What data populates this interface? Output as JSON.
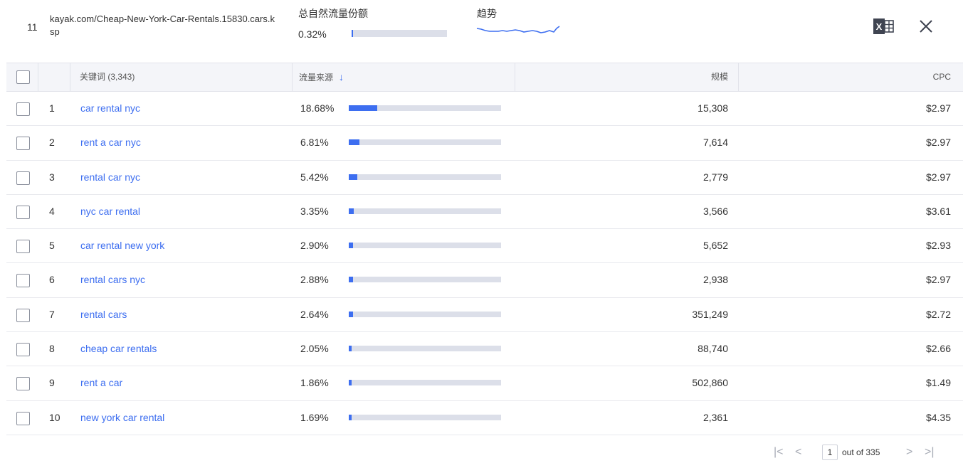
{
  "header": {
    "index": "11",
    "url": "kayak.com/Cheap-New-York-Car-Rentals.15830.cars.ksp",
    "share_label": "总自然流量份额",
    "share_value": "0.32%",
    "share_fraction": 0.0032,
    "trend_label": "趋势",
    "excel_icon": "excel-icon",
    "close_icon": "close-icon"
  },
  "table": {
    "columns": {
      "keyword": "关键词 (3,343)",
      "traffic": "流量来源",
      "volume": "规模",
      "cpc": "CPC"
    },
    "rows": [
      {
        "num": "1",
        "keyword": "car rental nyc",
        "pct": "18.68%",
        "fraction": 0.1868,
        "volume": "15,308",
        "cpc": "$2.97"
      },
      {
        "num": "2",
        "keyword": "rent a car nyc",
        "pct": "6.81%",
        "fraction": 0.0681,
        "volume": "7,614",
        "cpc": "$2.97"
      },
      {
        "num": "3",
        "keyword": "rental car nyc",
        "pct": "5.42%",
        "fraction": 0.0542,
        "volume": "2,779",
        "cpc": "$2.97"
      },
      {
        "num": "4",
        "keyword": "nyc car rental",
        "pct": "3.35%",
        "fraction": 0.0335,
        "volume": "3,566",
        "cpc": "$3.61"
      },
      {
        "num": "5",
        "keyword": "car rental new york",
        "pct": "2.90%",
        "fraction": 0.029,
        "volume": "5,652",
        "cpc": "$2.93"
      },
      {
        "num": "6",
        "keyword": "rental cars nyc",
        "pct": "2.88%",
        "fraction": 0.0288,
        "volume": "2,938",
        "cpc": "$2.97"
      },
      {
        "num": "7",
        "keyword": "rental cars",
        "pct": "2.64%",
        "fraction": 0.0264,
        "volume": "351,249",
        "cpc": "$2.72"
      },
      {
        "num": "8",
        "keyword": "cheap car rentals",
        "pct": "2.05%",
        "fraction": 0.0205,
        "volume": "88,740",
        "cpc": "$2.66"
      },
      {
        "num": "9",
        "keyword": "rent a car",
        "pct": "1.86%",
        "fraction": 0.0186,
        "volume": "502,860",
        "cpc": "$1.49"
      },
      {
        "num": "10",
        "keyword": "new york car rental",
        "pct": "1.69%",
        "fraction": 0.0169,
        "volume": "2,361",
        "cpc": "$4.35"
      }
    ]
  },
  "pagination": {
    "current_page": "1",
    "total_label": "out of 335"
  },
  "colors": {
    "accent": "#3d6ef0",
    "track": "#dcdfe9",
    "header_bg": "#f4f5f9"
  }
}
